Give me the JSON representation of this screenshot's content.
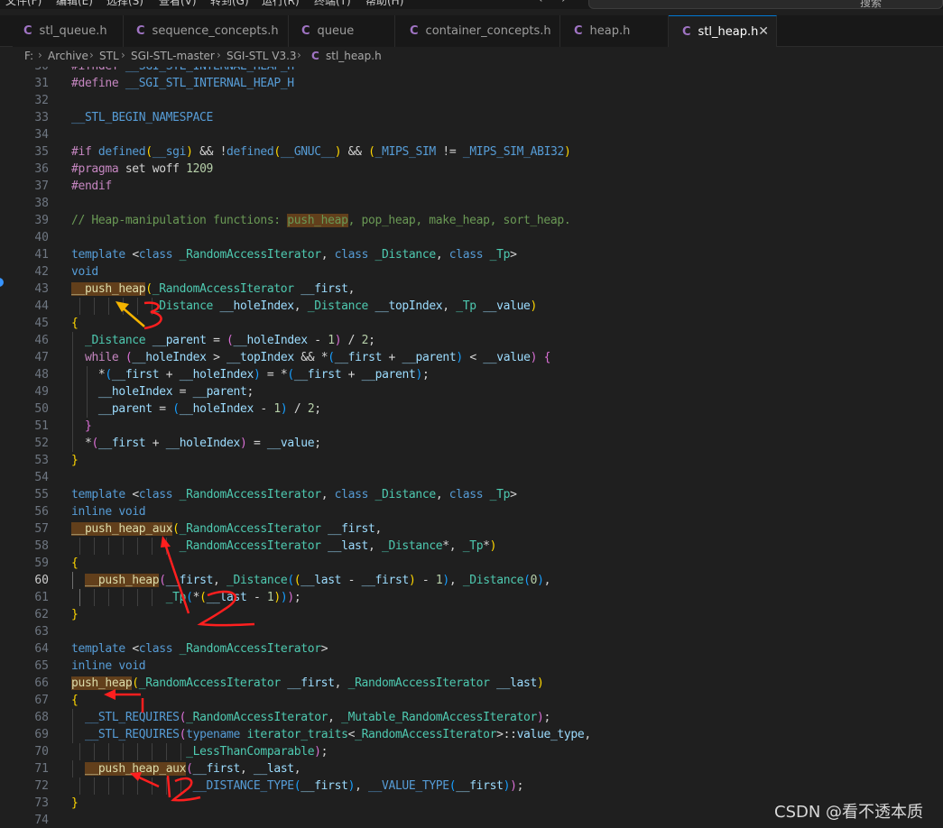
{
  "menubar": {
    "items": [
      "文件(F)",
      "编辑(E)",
      "选择(S)",
      "查看(V)",
      "转到(G)",
      "运行(R)",
      "终端(T)",
      "帮助(H)"
    ],
    "search_label": "搜索"
  },
  "tabs": [
    {
      "label": "stl_queue.h",
      "icon": "c-file-icon",
      "active": false
    },
    {
      "label": "sequence_concepts.h",
      "icon": "c-file-icon",
      "active": false
    },
    {
      "label": "queue",
      "icon": "c-file-icon",
      "active": false
    },
    {
      "label": "container_concepts.h",
      "icon": "c-file-icon",
      "active": false
    },
    {
      "label": "heap.h",
      "icon": "c-file-icon",
      "active": false
    },
    {
      "label": "stl_heap.h",
      "icon": "c-file-icon",
      "active": true
    }
  ],
  "tab_close_glyph": "✕",
  "file_type_glyph": "C",
  "breadcrumb": [
    "F:",
    "Archive",
    "STL",
    "SGI-STL-master",
    "SGI-STL V3.3",
    "stl_heap.h"
  ],
  "editor": {
    "current_line": 60,
    "lines": [
      {
        "n": "30",
        "t": "#ifndef __SGI_STL_INTERNAL_HEAP_H"
      },
      {
        "n": "31",
        "t": "#define __SGI_STL_INTERNAL_HEAP_H"
      },
      {
        "n": "32",
        "t": ""
      },
      {
        "n": "33",
        "t": "__STL_BEGIN_NAMESPACE"
      },
      {
        "n": "34",
        "t": ""
      },
      {
        "n": "35",
        "t": "#if defined(__sgi) && !defined(__GNUC__) && (_MIPS_SIM != _MIPS_SIM_ABI32)"
      },
      {
        "n": "36",
        "t": "#pragma set woff 1209"
      },
      {
        "n": "37",
        "t": "#endif"
      },
      {
        "n": "38",
        "t": ""
      },
      {
        "n": "39",
        "t": "// Heap-manipulation functions: push_heap, pop_heap, make_heap, sort_heap."
      },
      {
        "n": "40",
        "t": ""
      },
      {
        "n": "41",
        "t": "template <class _RandomAccessIterator, class _Distance, class _Tp>"
      },
      {
        "n": "42",
        "t": "void"
      },
      {
        "n": "43",
        "t": "__push_heap(_RandomAccessIterator __first,"
      },
      {
        "n": "44",
        "t": "            _Distance __holeIndex, _Distance __topIndex, _Tp __value)"
      },
      {
        "n": "45",
        "t": "{"
      },
      {
        "n": "46",
        "t": "  _Distance __parent = (__holeIndex - 1) / 2;"
      },
      {
        "n": "47",
        "t": "  while (__holeIndex > __topIndex && *(__first + __parent) < __value) {"
      },
      {
        "n": "48",
        "t": "    *(__first + __holeIndex) = *(__first + __parent);"
      },
      {
        "n": "49",
        "t": "    __holeIndex = __parent;"
      },
      {
        "n": "50",
        "t": "    __parent = (__holeIndex - 1) / 2;"
      },
      {
        "n": "51",
        "t": "  }"
      },
      {
        "n": "52",
        "t": "  *(__first + __holeIndex) = __value;"
      },
      {
        "n": "53",
        "t": "}"
      },
      {
        "n": "54",
        "t": ""
      },
      {
        "n": "55",
        "t": "template <class _RandomAccessIterator, class _Distance, class _Tp>"
      },
      {
        "n": "56",
        "t": "inline void"
      },
      {
        "n": "57",
        "t": "__push_heap_aux(_RandomAccessIterator __first,"
      },
      {
        "n": "58",
        "t": "                _RandomAccessIterator __last, _Distance*, _Tp*)"
      },
      {
        "n": "59",
        "t": "{"
      },
      {
        "n": "60",
        "t": "  __push_heap(__first, _Distance((__last - __first) - 1), _Distance(0),"
      },
      {
        "n": "61",
        "t": "              _Tp(*(__last - 1)));"
      },
      {
        "n": "62",
        "t": "}"
      },
      {
        "n": "63",
        "t": ""
      },
      {
        "n": "64",
        "t": "template <class _RandomAccessIterator>"
      },
      {
        "n": "65",
        "t": "inline void"
      },
      {
        "n": "66",
        "t": "push_heap(_RandomAccessIterator __first, _RandomAccessIterator __last)"
      },
      {
        "n": "67",
        "t": "{"
      },
      {
        "n": "68",
        "t": "  __STL_REQUIRES(_RandomAccessIterator, _Mutable_RandomAccessIterator);"
      },
      {
        "n": "69",
        "t": "  __STL_REQUIRES(typename iterator_traits<_RandomAccessIterator>::value_type,"
      },
      {
        "n": "70",
        "t": "                 _LessThanComparable);"
      },
      {
        "n": "71",
        "t": "  __push_heap_aux(__first, __last,"
      },
      {
        "n": "72",
        "t": "                  __DISTANCE_TYPE(__first), __VALUE_TYPE(__first));"
      },
      {
        "n": "73",
        "t": "}"
      },
      {
        "n": "74",
        "t": ""
      }
    ]
  },
  "annotations": {
    "labels": [
      "3",
      "2",
      "2"
    ],
    "color": "#ff1f1f",
    "arrow_color": "#f5b400"
  },
  "watermark": "CSDN @看不透本质",
  "colors": {
    "accent": "#0078d4",
    "highlight": "#623f1b",
    "keyword": "#569cd6",
    "type": "#4ec9b0",
    "comment": "#6a9955"
  }
}
